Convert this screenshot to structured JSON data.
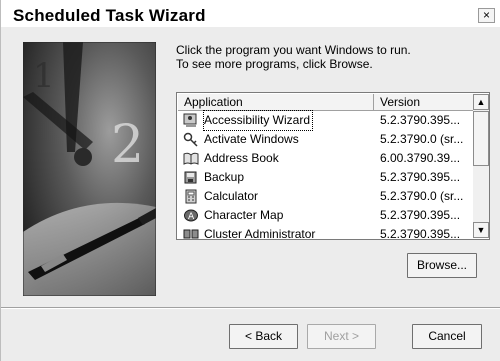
{
  "window": {
    "title": "Scheduled Task Wizard",
    "close_label": "×"
  },
  "instructions": {
    "line1": "Click the program you want Windows to run.",
    "line2": "To see more programs, click Browse."
  },
  "list": {
    "columns": [
      "Application",
      "Version"
    ],
    "rows": [
      {
        "name": "Accessibility Wizard",
        "version": "5.2.3790.395...",
        "icon": "accessibility-wizard-icon",
        "selected": true
      },
      {
        "name": "Activate Windows",
        "version": "5.2.3790.0 (sr...",
        "icon": "activate-windows-icon"
      },
      {
        "name": "Address Book",
        "version": "6.00.3790.39...",
        "icon": "address-book-icon"
      },
      {
        "name": "Backup",
        "version": "5.2.3790.395...",
        "icon": "backup-icon"
      },
      {
        "name": "Calculator",
        "version": "5.2.3790.0 (sr...",
        "icon": "calculator-icon"
      },
      {
        "name": "Character Map",
        "version": "5.2.3790.395...",
        "icon": "character-map-icon"
      },
      {
        "name": "Cluster Administrator",
        "version": "5.2.3790.395...",
        "icon": "cluster-administrator-icon"
      }
    ]
  },
  "buttons": {
    "browse": "Browse...",
    "back": "< Back",
    "next": "Next >",
    "cancel": "Cancel"
  },
  "scrollbar": {
    "up_arrow": "▲",
    "down_arrow": "▼"
  },
  "colors": {
    "dialog_bg": "#ececec",
    "title_bg": "#ffffff",
    "list_bg": "#ffffff"
  }
}
